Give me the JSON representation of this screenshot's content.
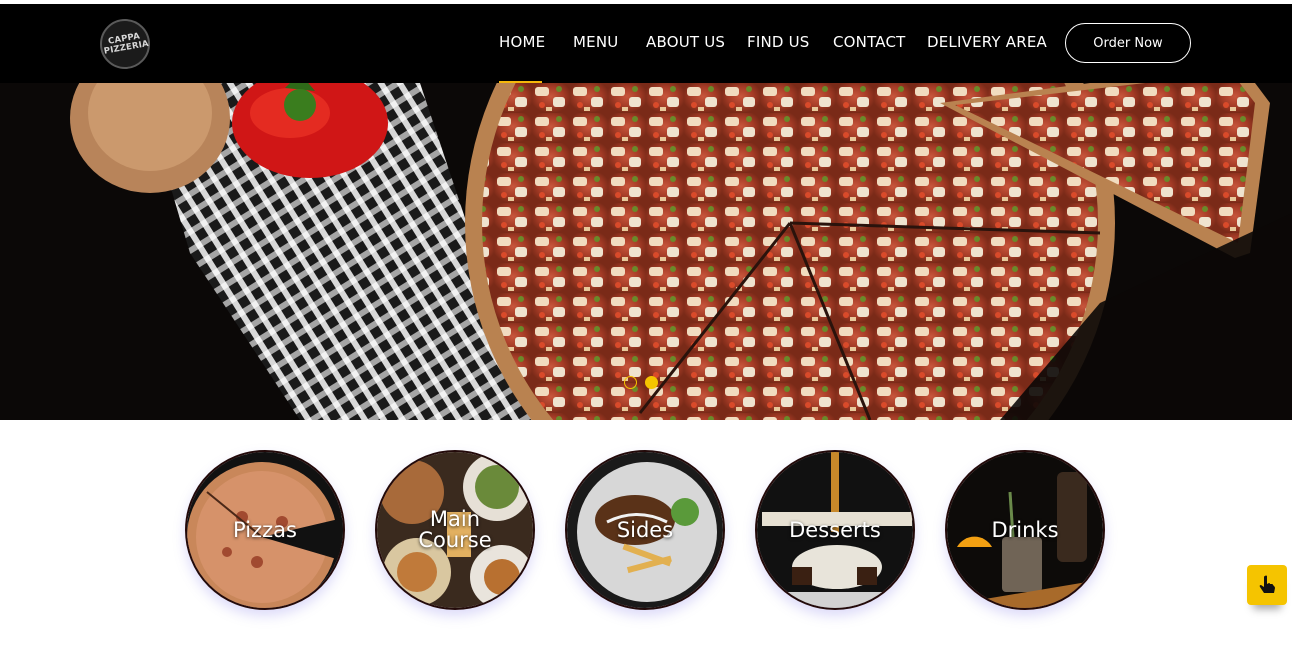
{
  "brand": {
    "logo_text": "CAPPA PIZZERIA"
  },
  "nav": {
    "items": [
      {
        "label": "HOME",
        "active": true
      },
      {
        "label": "MENU"
      },
      {
        "label": "ABOUT US"
      },
      {
        "label": "FIND US"
      },
      {
        "label": "CONTACT"
      },
      {
        "label": "DELIVERY AREA"
      }
    ],
    "order_button": "Order Now"
  },
  "hero": {
    "slides": 2,
    "active_slide": 2
  },
  "categories": [
    {
      "label": "Pizzas"
    },
    {
      "label": "Main Course"
    },
    {
      "label": "Sides"
    },
    {
      "label": "Desserts"
    },
    {
      "label": "Drinks"
    }
  ],
  "colors": {
    "accent": "#f5c400",
    "header_bg": "#000000"
  },
  "help_button": {
    "icon": "hand-pointer-icon"
  }
}
